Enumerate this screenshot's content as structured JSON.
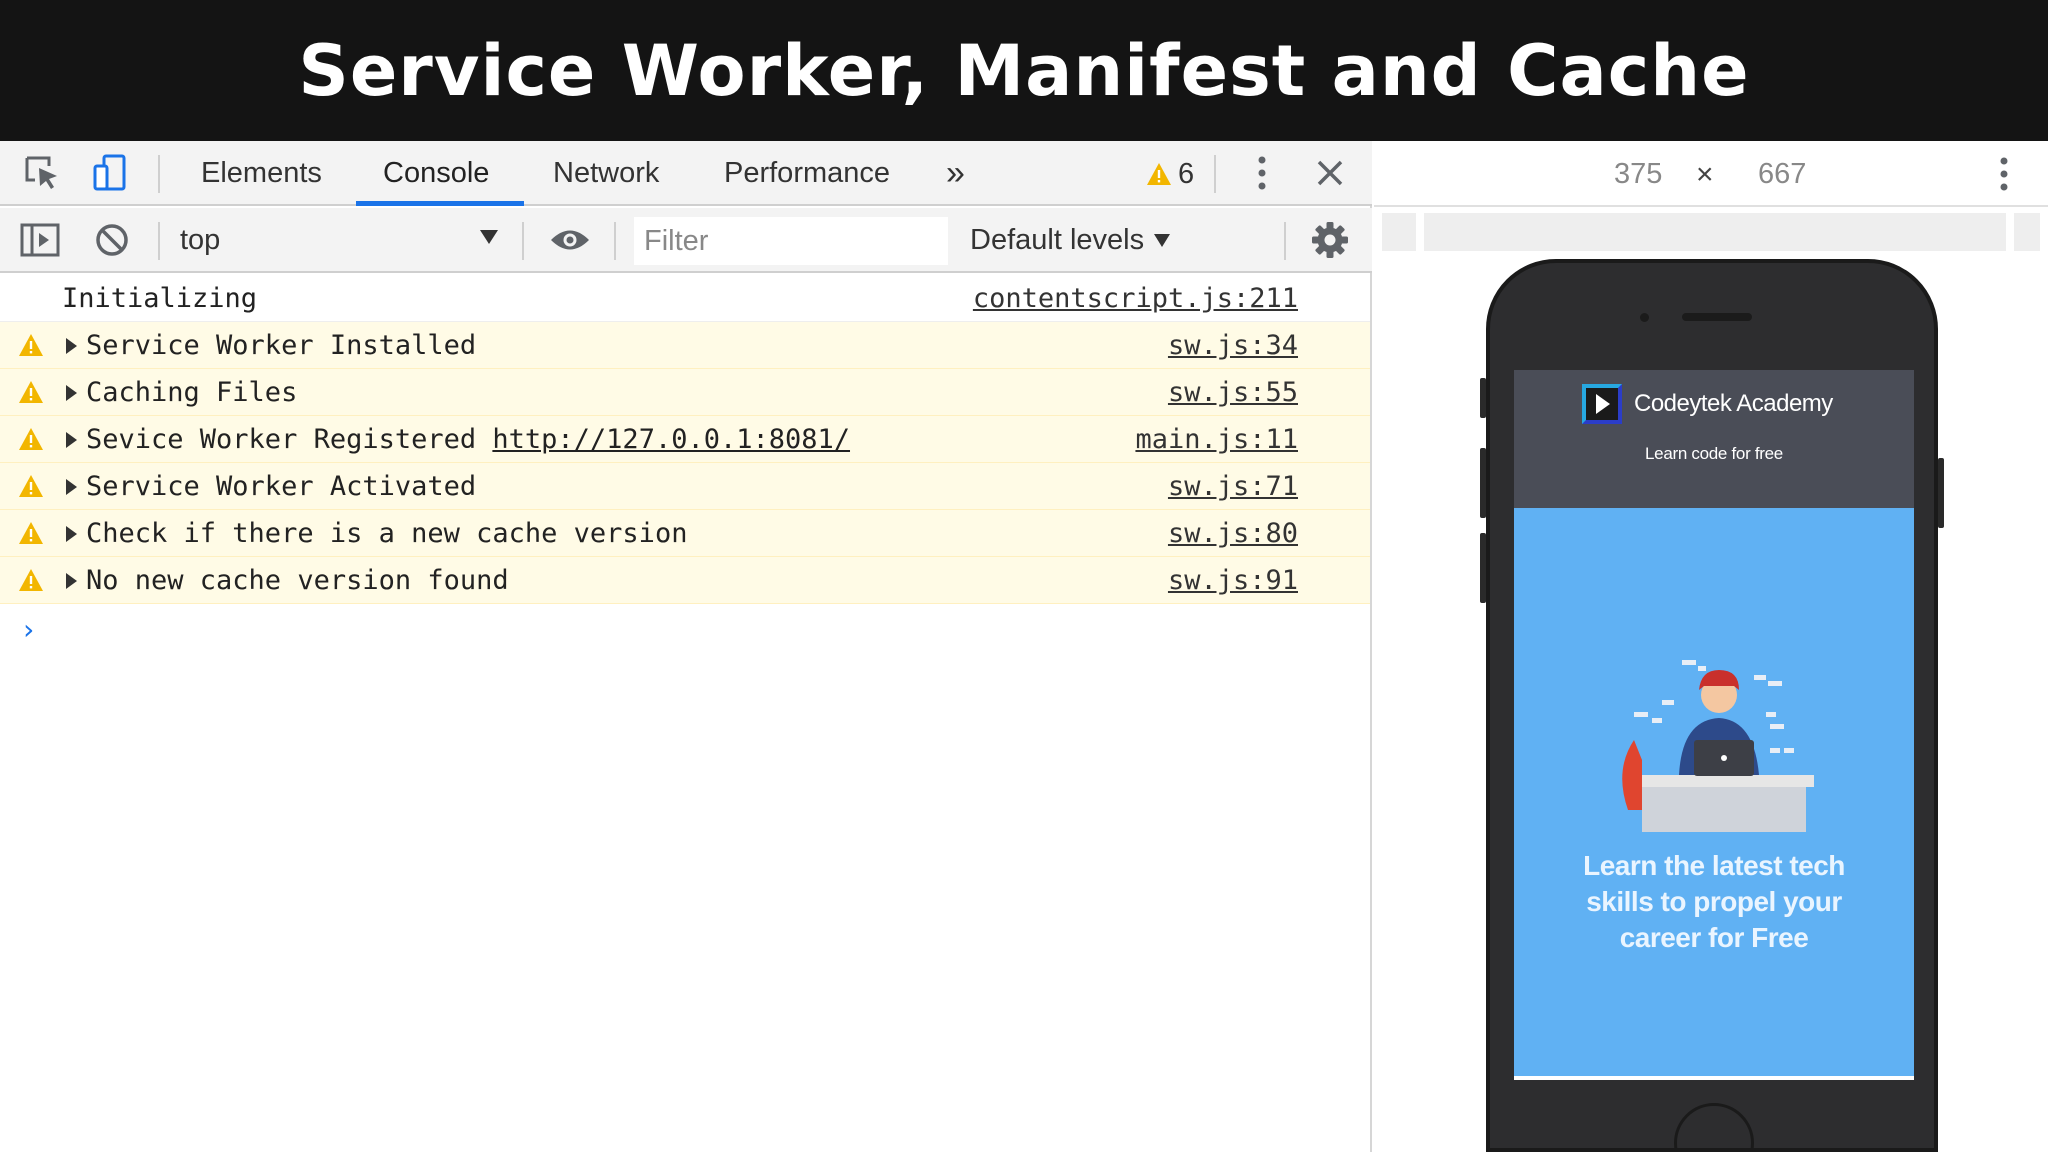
{
  "banner": {
    "title": "Service Worker, Manifest and Cache"
  },
  "devtools": {
    "tabs": [
      {
        "label": "Elements",
        "active": false
      },
      {
        "label": "Console",
        "active": true
      },
      {
        "label": "Network",
        "active": false
      },
      {
        "label": "Performance",
        "active": false
      }
    ],
    "overflow_glyph": "»",
    "warning_count": "6",
    "toolbar": {
      "context": "top",
      "filter_placeholder": "Filter",
      "levels_label": "Default levels"
    },
    "console_rows": [
      {
        "level": "info",
        "message": "Initializing",
        "source": "contentscript.js:211"
      },
      {
        "level": "warn",
        "message": "Service Worker Installed",
        "source": "sw.js:34"
      },
      {
        "level": "warn",
        "message": "Caching Files",
        "source": "sw.js:55"
      },
      {
        "level": "warn",
        "message": "Sevice Worker Registered ",
        "link": "http://127.0.0.1:8081/",
        "source": "main.js:11"
      },
      {
        "level": "warn",
        "message": "Service Worker Activated",
        "source": "sw.js:71"
      },
      {
        "level": "warn",
        "message": "Check if there is a new cache version",
        "source": "sw.js:80"
      },
      {
        "level": "warn",
        "message": "No new cache version found",
        "source": "sw.js:91"
      }
    ],
    "prompt_glyph": "›"
  },
  "device": {
    "width": "375",
    "times": "×",
    "height": "667",
    "app": {
      "name": "Codeytek Academy",
      "tagline": "Learn code for free",
      "hero_line1": "Learn the latest tech",
      "hero_line2": "skills to propel your",
      "hero_line3": "career for Free"
    }
  },
  "colors": {
    "banner_bg": "#141414",
    "warn_bg": "#fffbe6",
    "accent_blue": "#1a73e8",
    "warn_yellow": "#f2b600",
    "hero_blue": "#60b1f3",
    "app_header": "#4a4d57"
  }
}
